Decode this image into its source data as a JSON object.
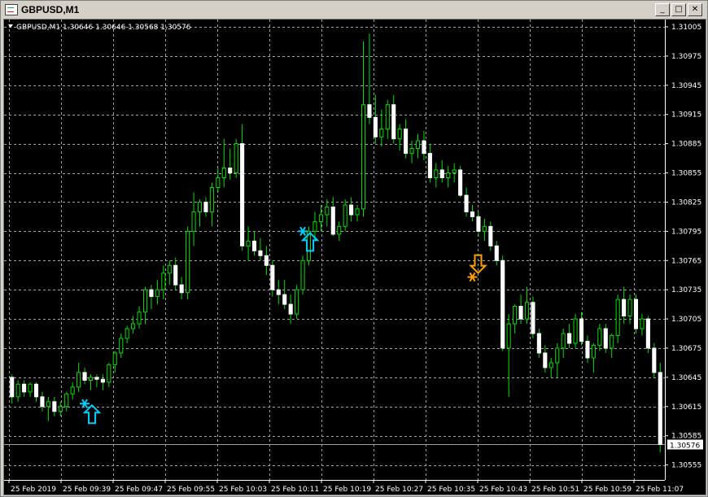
{
  "window": {
    "title": "GBPUSD,M1",
    "buttons": {
      "minimize": "_",
      "maximize": "□",
      "close": "✕"
    }
  },
  "colors": {
    "background": "#000000",
    "grid": "#a0a0a0",
    "bull_body": "#000000",
    "bear_body": "#ffffff",
    "bull_stroke": "#00e000",
    "bear_stroke": "#ffffff",
    "wick": "#00e000",
    "buy_arrow": "#00d0ff",
    "sell_arrow": "#ffa000",
    "price_line": "#a0a0a0"
  },
  "chart_data": {
    "type": "candlestick",
    "symbol_caption": "GBPUSD,M1  1.30646 1.30646 1.30568 1.30576",
    "current_price_label": "1.30576",
    "ylim": [
      1.30548,
      1.31005
    ],
    "y_ticks": [
      "1.31005",
      "1.30975",
      "1.30945",
      "1.30915",
      "1.30885",
      "1.30855",
      "1.30825",
      "1.30795",
      "1.30765",
      "1.30735",
      "1.30705",
      "1.30675",
      "1.30645",
      "1.30615",
      "1.30585",
      "1.30555"
    ],
    "x_labels": [
      "25 Feb 2019",
      "25 Feb 09:39",
      "25 Feb 09:47",
      "25 Feb 09:55",
      "25 Feb 10:03",
      "25 Feb 10:11",
      "25 Feb 10:19",
      "25 Feb 10:27",
      "25 Feb 10:35",
      "25 Feb 10:43",
      "25 Feb 10:51",
      "25 Feb 10:59",
      "25 Feb 11:07"
    ],
    "candles": [
      [
        1.30645,
        1.30648,
        1.30618,
        1.30625
      ],
      [
        1.30625,
        1.30642,
        1.3062,
        1.30638
      ],
      [
        1.30638,
        1.30642,
        1.30625,
        1.3063
      ],
      [
        1.3063,
        1.3064,
        1.30625,
        1.30638
      ],
      [
        1.30638,
        1.3064,
        1.3062,
        1.30625
      ],
      [
        1.30625,
        1.3063,
        1.3061,
        1.30615
      ],
      [
        1.30615,
        1.30625,
        1.306,
        1.3062
      ],
      [
        1.3062,
        1.30625,
        1.30605,
        1.3061
      ],
      [
        1.3061,
        1.3062,
        1.30605,
        1.30615
      ],
      [
        1.30615,
        1.3063,
        1.3061,
        1.30628
      ],
      [
        1.30628,
        1.3064,
        1.30622,
        1.30635
      ],
      [
        1.30635,
        1.3066,
        1.3063,
        1.3065
      ],
      [
        1.3065,
        1.30655,
        1.30638,
        1.30642
      ],
      [
        1.30642,
        1.30648,
        1.30632,
        1.30645
      ],
      [
        1.30645,
        1.30648,
        1.30635,
        1.30643
      ],
      [
        1.30643,
        1.30648,
        1.30632,
        1.3064
      ],
      [
        1.3064,
        1.3066,
        1.30635,
        1.30658
      ],
      [
        1.30658,
        1.30672,
        1.3065,
        1.3067
      ],
      [
        1.3067,
        1.3069,
        1.30665,
        1.30685
      ],
      [
        1.30685,
        1.30698,
        1.3068,
        1.30695
      ],
      [
        1.30695,
        1.30708,
        1.3069,
        1.307
      ],
      [
        1.307,
        1.30718,
        1.30695,
        1.30712
      ],
      [
        1.30712,
        1.30738,
        1.307,
        1.30735
      ],
      [
        1.30735,
        1.3074,
        1.30715,
        1.30728
      ],
      [
        1.30728,
        1.30745,
        1.3072,
        1.30735
      ],
      [
        1.30735,
        1.3076,
        1.30725,
        1.30752
      ],
      [
        1.30752,
        1.30765,
        1.3074,
        1.3076
      ],
      [
        1.3076,
        1.30768,
        1.30735,
        1.3074
      ],
      [
        1.3074,
        1.30748,
        1.30725,
        1.30732
      ],
      [
        1.30732,
        1.308,
        1.30725,
        1.30795
      ],
      [
        1.30795,
        1.30835,
        1.3078,
        1.30815
      ],
      [
        1.30815,
        1.30828,
        1.308,
        1.30825
      ],
      [
        1.30825,
        1.3083,
        1.3081,
        1.30815
      ],
      [
        1.30815,
        1.30845,
        1.308,
        1.3084
      ],
      [
        1.3084,
        1.3086,
        1.30835,
        1.3085
      ],
      [
        1.3085,
        1.3089,
        1.3084,
        1.3086
      ],
      [
        1.3086,
        1.3088,
        1.30848,
        1.30855
      ],
      [
        1.30855,
        1.3089,
        1.3085,
        1.30885
      ],
      [
        1.30885,
        1.30905,
        1.30775,
        1.3078
      ],
      [
        1.3078,
        1.308,
        1.30765,
        1.30785
      ],
      [
        1.30785,
        1.30795,
        1.3077,
        1.30775
      ],
      [
        1.30775,
        1.30788,
        1.30765,
        1.3077
      ],
      [
        1.3077,
        1.3078,
        1.3075,
        1.3076
      ],
      [
        1.3076,
        1.30765,
        1.30728,
        1.30735
      ],
      [
        1.30735,
        1.30745,
        1.3072,
        1.3073
      ],
      [
        1.3073,
        1.30745,
        1.30715,
        1.3072
      ],
      [
        1.3072,
        1.3073,
        1.307,
        1.3071
      ],
      [
        1.3071,
        1.3074,
        1.30705,
        1.30735
      ],
      [
        1.30735,
        1.3077,
        1.3073,
        1.30765
      ],
      [
        1.30765,
        1.308,
        1.3076,
        1.30795
      ],
      [
        1.30795,
        1.30815,
        1.30785,
        1.30805
      ],
      [
        1.30805,
        1.30822,
        1.30795,
        1.30812
      ],
      [
        1.30812,
        1.30828,
        1.308,
        1.3082
      ],
      [
        1.3082,
        1.3083,
        1.3079,
        1.30792
      ],
      [
        1.30792,
        1.30805,
        1.30785,
        1.308
      ],
      [
        1.308,
        1.30828,
        1.30795,
        1.30822
      ],
      [
        1.30822,
        1.3083,
        1.30805,
        1.30812
      ],
      [
        1.30812,
        1.30822,
        1.30805,
        1.30818
      ],
      [
        1.30818,
        1.3099,
        1.3081,
        1.30925
      ],
      [
        1.30925,
        1.30998,
        1.30905,
        1.30912
      ],
      [
        1.30912,
        1.30935,
        1.30885,
        1.30892
      ],
      [
        1.30892,
        1.3092,
        1.30882,
        1.309
      ],
      [
        1.309,
        1.3093,
        1.3089,
        1.30925
      ],
      [
        1.30925,
        1.30935,
        1.30885,
        1.3089
      ],
      [
        1.3089,
        1.30905,
        1.30878,
        1.309
      ],
      [
        1.309,
        1.3091,
        1.3087,
        1.30875
      ],
      [
        1.30875,
        1.30888,
        1.30865,
        1.3088
      ],
      [
        1.3088,
        1.30895,
        1.3087,
        1.30888
      ],
      [
        1.30888,
        1.30898,
        1.30868,
        1.30875
      ],
      [
        1.30875,
        1.30885,
        1.30845,
        1.3085
      ],
      [
        1.3085,
        1.30865,
        1.3084,
        1.30858
      ],
      [
        1.30858,
        1.30868,
        1.30845,
        1.3085
      ],
      [
        1.3085,
        1.30862,
        1.3084,
        1.30855
      ],
      [
        1.30855,
        1.30865,
        1.30845,
        1.30858
      ],
      [
        1.30858,
        1.30862,
        1.3083,
        1.30832
      ],
      [
        1.30832,
        1.3084,
        1.3081,
        1.30815
      ],
      [
        1.30815,
        1.30822,
        1.30805,
        1.3081
      ],
      [
        1.3081,
        1.30815,
        1.3079,
        1.30795
      ],
      [
        1.30795,
        1.30808,
        1.30785,
        1.308
      ],
      [
        1.308,
        1.30805,
        1.30775,
        1.3078
      ],
      [
        1.3078,
        1.30785,
        1.3076,
        1.30765
      ],
      [
        1.30765,
        1.3077,
        1.30672,
        1.30675
      ],
      [
        1.30675,
        1.3071,
        1.30625,
        1.307
      ],
      [
        1.307,
        1.3072,
        1.3069,
        1.30718
      ],
      [
        1.30718,
        1.3073,
        1.307,
        1.30705
      ],
      [
        1.30705,
        1.30738,
        1.307,
        1.30722
      ],
      [
        1.30722,
        1.30728,
        1.30685,
        1.3069
      ],
      [
        1.3069,
        1.30695,
        1.30665,
        1.3067
      ],
      [
        1.3067,
        1.30678,
        1.3065,
        1.30655
      ],
      [
        1.30655,
        1.30665,
        1.30645,
        1.3066
      ],
      [
        1.3066,
        1.3068,
        1.30645,
        1.30675
      ],
      [
        1.30675,
        1.30695,
        1.30665,
        1.3069
      ],
      [
        1.3069,
        1.307,
        1.30675,
        1.3068
      ],
      [
        1.3068,
        1.3071,
        1.30675,
        1.30705
      ],
      [
        1.30705,
        1.30712,
        1.30678,
        1.30682
      ],
      [
        1.30682,
        1.30688,
        1.3066,
        1.30665
      ],
      [
        1.30665,
        1.3068,
        1.3065,
        1.30678
      ],
      [
        1.30678,
        1.307,
        1.30672,
        1.30695
      ],
      [
        1.30695,
        1.307,
        1.3067,
        1.30675
      ],
      [
        1.30675,
        1.3069,
        1.30665,
        1.30688
      ],
      [
        1.30688,
        1.3073,
        1.3068,
        1.30725
      ],
      [
        1.30725,
        1.30738,
        1.307,
        1.30708
      ],
      [
        1.30708,
        1.3073,
        1.307,
        1.30725
      ],
      [
        1.30725,
        1.3073,
        1.3069,
        1.30695
      ],
      [
        1.30695,
        1.3071,
        1.30688,
        1.30705
      ],
      [
        1.30705,
        1.30708,
        1.3067,
        1.30675
      ],
      [
        1.30675,
        1.3068,
        1.30645,
        1.3065
      ],
      [
        1.3065,
        1.3066,
        1.30568,
        1.30576
      ]
    ],
    "buy_signals": [
      {
        "index": 12,
        "price": 1.30618
      },
      {
        "index": 48,
        "price": 1.30795
      }
    ],
    "sell_signals": [
      {
        "index": 76,
        "price": 1.30748
      }
    ]
  }
}
